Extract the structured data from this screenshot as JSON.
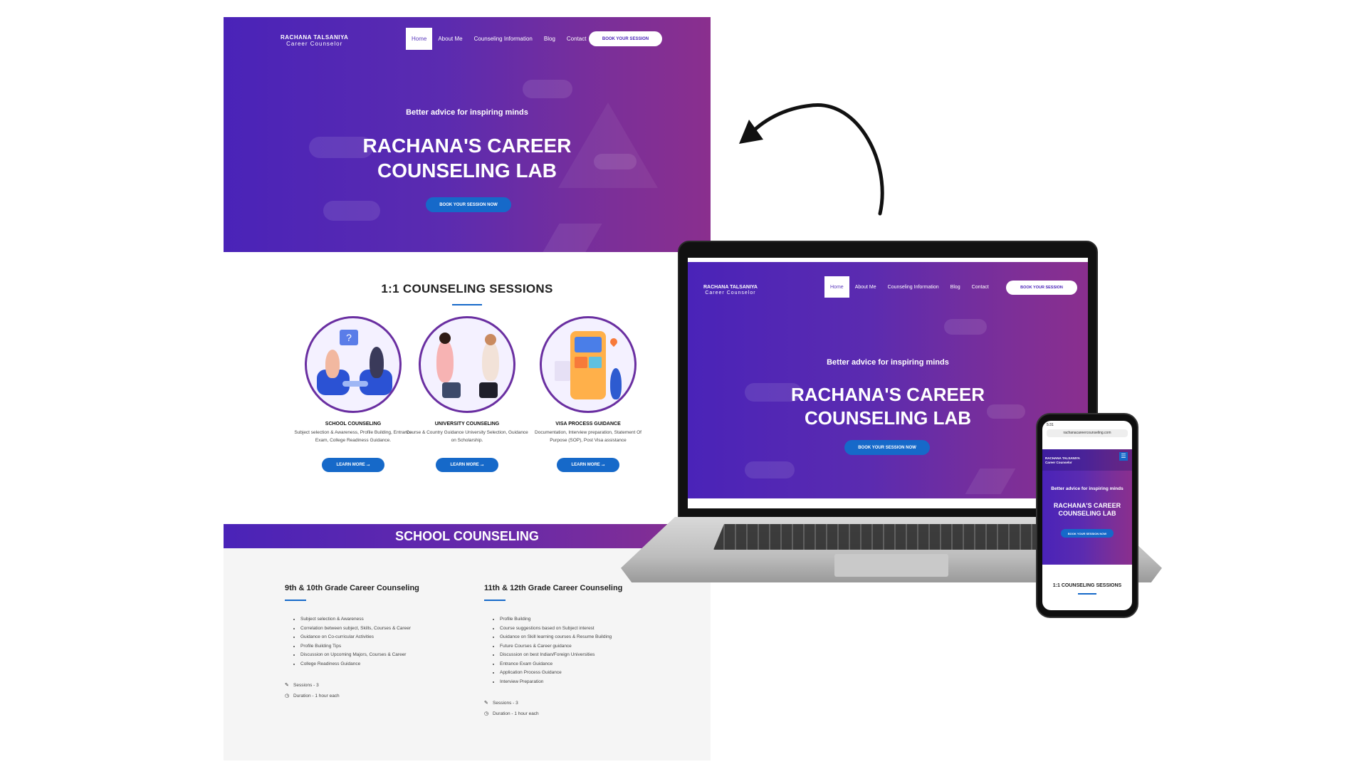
{
  "site": {
    "logo_line1": "RACHANA TALSANIYA",
    "logo_line2": "Career Counselor",
    "nav": [
      "Home",
      "About Me",
      "Counseling Information",
      "Blog",
      "Contact"
    ],
    "book_button": "BOOK YOUR SESSION",
    "tagline": "Better advice for inspiring minds",
    "headline_line1": "RACHANA'S CAREER",
    "headline_line2": "COUNSELING LAB",
    "cta": "BOOK YOUR SESSION NOW"
  },
  "sessions": {
    "title": "1:1 COUNSELING SESSIONS",
    "items": [
      {
        "name": "SCHOOL COUNSELING",
        "desc": "Subject selection & Awareness, Profile Building, Entrance Exam, College Readiness Guidance.",
        "button": "LEARN MORE"
      },
      {
        "name": "UNIVERSITY COUNSELING",
        "desc": "Course & Country Guidance University Selection, Guidance on Scholarship.",
        "button": "LEARN MORE"
      },
      {
        "name": "VISA PROCESS GUIDANCE",
        "desc": "Documentation, Interview preparation, Statement Of Purpose (SOP), Post Visa assistance",
        "button": "LEARN MORE"
      }
    ]
  },
  "school": {
    "banner": "SCHOOL COUNSELING",
    "col1": {
      "title": "9th & 10th Grade Career Counseling",
      "items": [
        "Subject selection & Awareness",
        "Correlation between subject, Skills, Courses & Career",
        "Guidance on Co-curricular Activities",
        "Profile Building Tips",
        "Discussion on Upcoming Majors, Courses & Career",
        "College Readiness Guidance"
      ],
      "sessions": "Sessions - 3",
      "duration": "Duration - 1 hour each"
    },
    "col2": {
      "title": "11th & 12th Grade Career Counseling",
      "items": [
        "Profile Building",
        "Course suggestions based on Subject interest",
        "Guidance on Skill learning courses & Resume Building",
        "Future Courses & Career guidance",
        "Discussion on best Indian/Foreign Universities",
        "Entrance Exam Guidance",
        "Application Process Guidance",
        "Interview Preparation"
      ],
      "sessions": "Sessions - 3",
      "duration": "Duration - 1 hour each"
    }
  },
  "phone": {
    "time": "5:31",
    "url": "rachanacareercounseling.com",
    "logo_line1": "RACHANA TALSANIYA",
    "logo_line2": "Career Counselor",
    "tagline": "Better advice for inspiring minds",
    "headline_line1": "RACHANA'S CAREER",
    "headline_line2": "COUNSELING LAB",
    "cta": "BOOK YOUR SESSION NOW",
    "sessions_title": "1:1 COUNSELING SESSIONS"
  },
  "colors": {
    "gradient_start": "#4a23b8",
    "gradient_end": "#8a2f8e",
    "accent_blue": "#1669c9",
    "circle_border": "#6a2fa1"
  },
  "icons": {
    "pencil": "pencil-icon",
    "clock": "clock-icon",
    "arrow": "arrow-right-icon",
    "menu": "hamburger-menu-icon"
  }
}
